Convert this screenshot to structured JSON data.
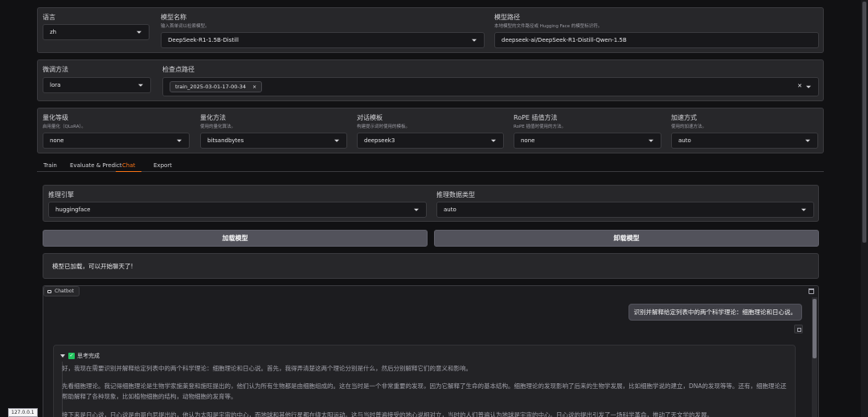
{
  "top": {
    "lang_label": "语言",
    "lang_value": "zh",
    "model_name_label": "模型名称",
    "model_name_sub": "输入首单词以检索模型。",
    "model_name_value": "DeepSeek-R1-1.5B-Distill",
    "model_path_label": "模型路径",
    "model_path_sub": "本地模型的文件路径或 Hugging Face 的模型标识符。",
    "model_path_value": "deepseek-ai/DeepSeek-R1-Distill-Qwen-1.5B"
  },
  "finetune": {
    "method_label": "微调方法",
    "method_value": "lora",
    "checkpoint_label": "检查点路径",
    "checkpoint_chip": "train_2025-03-01-17-00-34",
    "chip_close": "×",
    "clear_icon": "✕"
  },
  "advanced": {
    "quant_bit_label": "量化等级",
    "quant_bit_sub": "启用量化（QLoRA）。",
    "quant_bit_value": "none",
    "quant_method_label": "量化方法",
    "quant_method_sub": "使用的量化算法。",
    "quant_method_value": "bitsandbytes",
    "template_label": "对话模板",
    "template_sub": "构建提示词时使用的模板。",
    "template_value": "deepseek3",
    "rope_label": "RoPE 插值方法",
    "rope_sub": "RoPE 插值时使用的方法。",
    "rope_value": "none",
    "booster_label": "加速方式",
    "booster_sub": "使用的加速方法。",
    "booster_value": "auto"
  },
  "tabs": [
    "Train",
    "Evaluate & Predict",
    "Chat",
    "Export"
  ],
  "chat": {
    "infer_backend_label": "推理引擎",
    "infer_backend_value": "huggingface",
    "infer_dtype_label": "推理数据类型",
    "infer_dtype_value": "auto",
    "load_button": "加载模型",
    "unload_button": "卸载模型",
    "info_box": "模型已加载，可以开始聊天了!",
    "chatbot_label": "Chatbot",
    "user_message": "识别并解释给定列表中的两个科学理论：细胞理论和日心说。",
    "thinking_title": "思考完成",
    "paragraph1": "好，我现在需要识别并解释给定列表中的两个科学理论：细胞理论和日心说。首先，我得弄清楚这两个理论分别是什么，然后分别解释它们的意义和影响。",
    "paragraph2": "先看细胞理论。我记得细胞理论是生物学家施莱登和施旺提出的，他们认为所有生物都是由细胞组成的。这在当时是一个非常重要的发现，因为它解释了生命的基本结构。细胞理论的发现影响了后来的生物学发展，比如细胞学说的建立，DNA的发现等等。还有，细胞理论还帮助解释了各种现象，比如植物细胞的结构，动物细胞的发育等。",
    "paragraph3": "接下来是日心说，日心说是由哥白尼提出的，他认为太阳是宇宙的中心，而地球和其他行星都在绕太阳运动。这与当时普遍接受的地心说相对立，当时的人们普遍认为地球是宇宙的中心。日心说的提出引发了一场科学革命，推动了天文学的发展。"
  },
  "url_badge": "127.0.0.1",
  "icons": {
    "dropdown": "chevron-down-icon",
    "chat": "chat-bubble-icon",
    "trash": "trash-icon",
    "copy": "copy-icon",
    "check": "check-icon",
    "triangle": "triangle-down-icon"
  }
}
